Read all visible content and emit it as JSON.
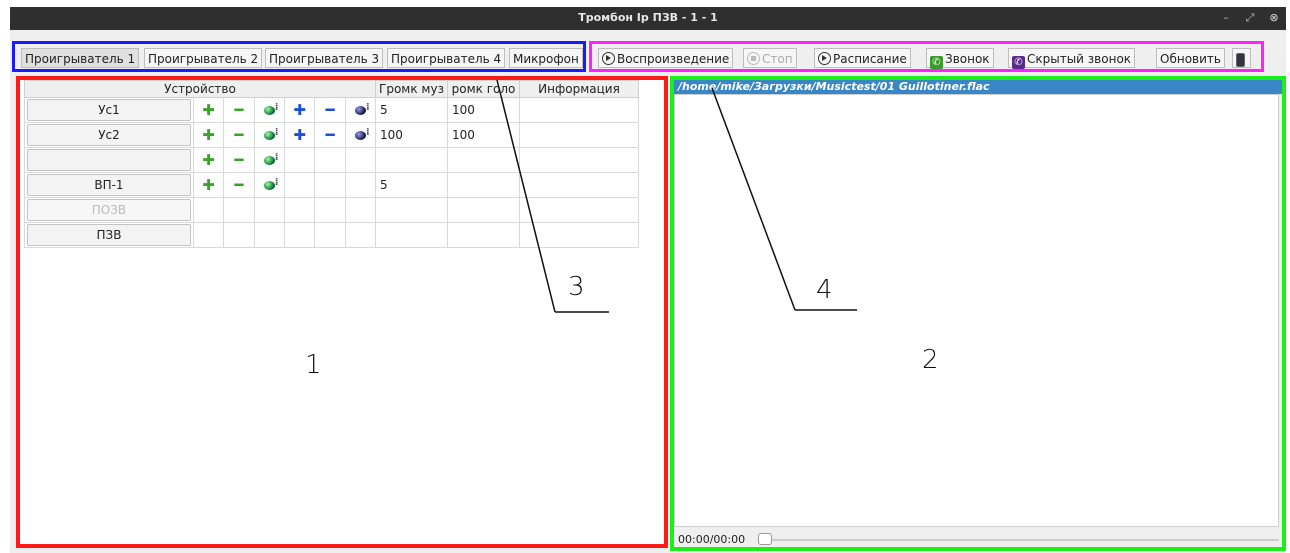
{
  "window": {
    "title": "Тромбон Ip ПЗВ - 1 - 1"
  },
  "tabs": [
    {
      "label": "Проигрыватель 1",
      "selected": true
    },
    {
      "label": "Проигрыватель 2"
    },
    {
      "label": "Проигрыватель 3"
    },
    {
      "label": "Проигрыватель 4"
    },
    {
      "label": "Микрофон"
    }
  ],
  "toolbar": {
    "play_label": "Воспроизведение",
    "stop_label": "Стоп",
    "schedule_label": "Расписание",
    "call_label": "Звонок",
    "hidden_call_label": "Скрытый звонок",
    "refresh_label": "Обновить"
  },
  "table": {
    "headers": [
      "Устройство",
      "Громк муз",
      "ромк голо",
      "Информация"
    ],
    "rows": [
      {
        "device": "Ус1",
        "music_volume": "5",
        "voice_volume": "100",
        "info": ""
      },
      {
        "device": "Ус2",
        "music_volume": "100",
        "voice_volume": "100",
        "info": ""
      },
      {
        "device": "",
        "music_volume": "",
        "voice_volume": "",
        "info": ""
      },
      {
        "device": "ВП-1",
        "music_volume": "5",
        "voice_volume": "",
        "info": ""
      },
      {
        "device": "ПОЗВ",
        "music_volume": "",
        "voice_volume": "",
        "info": ""
      },
      {
        "device": "ПЗВ",
        "music_volume": "",
        "voice_volume": "",
        "info": ""
      }
    ]
  },
  "playlist": {
    "path": "/home/mike/Загрузки/Musictest/01 Guillotiner.flac",
    "time": "00:00/00:00"
  },
  "annotations": {
    "a1": "1",
    "a2": "2",
    "a3": "3",
    "a4": "4"
  },
  "colors": {
    "left_frame": "#ff1a1a",
    "right_frame": "#1aef1a",
    "tabs_frame": "#1a1aff",
    "buttons_frame": "#ff20ff",
    "path_bar": "#3a87c8"
  }
}
